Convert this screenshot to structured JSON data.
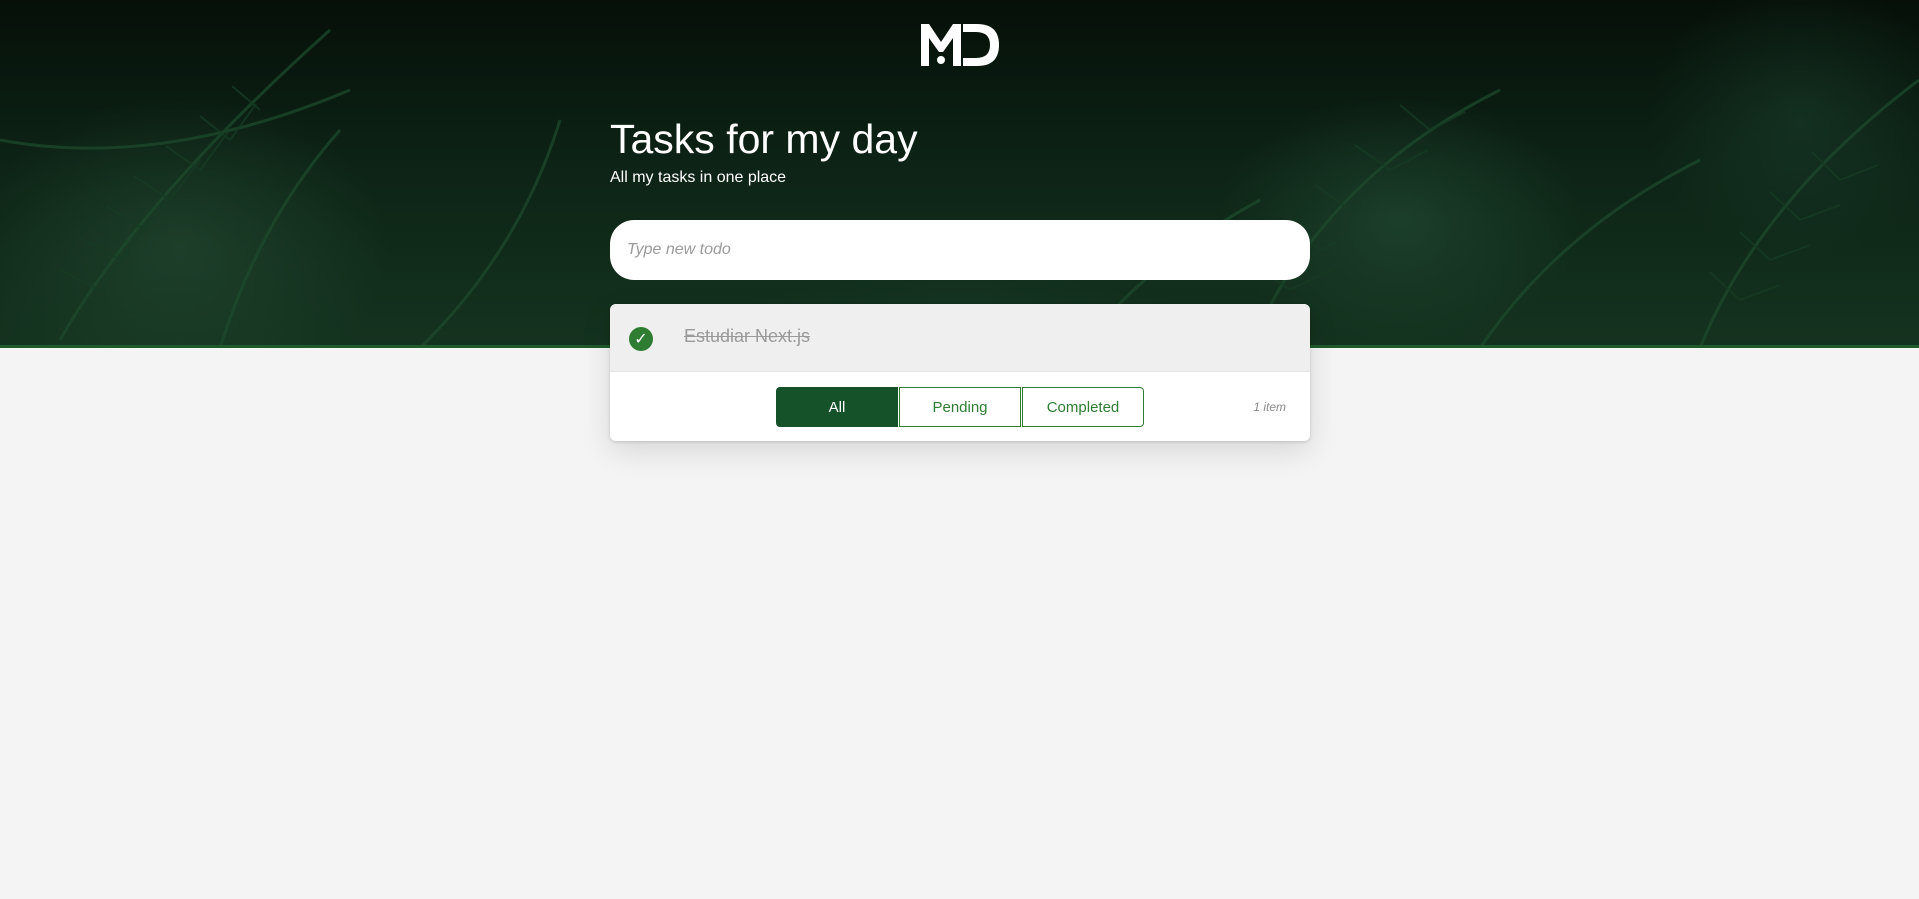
{
  "header": {
    "logo_text": "MD",
    "title": "Tasks for my day",
    "subtitle": "All my tasks in one place"
  },
  "new_todo": {
    "placeholder": "Type new todo",
    "value": ""
  },
  "todos": [
    {
      "text": "Estudiar Next.js",
      "completed": true
    }
  ],
  "filters": {
    "all_label": "All",
    "pending_label": "Pending",
    "completed_label": "Completed",
    "active": "All"
  },
  "footer": {
    "count_text": "1 item"
  },
  "colors": {
    "accent": "#2e7d32",
    "accent_dark": "#155229",
    "page_bg": "#f4f4f4"
  },
  "icons": {
    "logo": "md-logo-icon",
    "todo_check": "check-circle-icon"
  }
}
